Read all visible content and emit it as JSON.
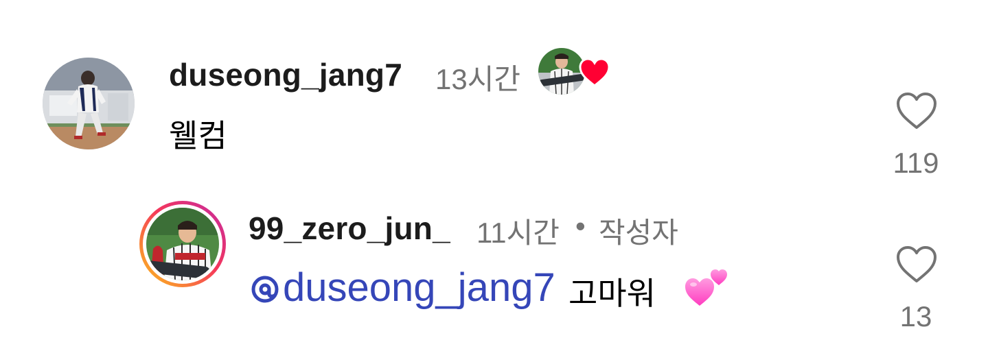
{
  "comment": {
    "username": "duseong_jang7",
    "time": "13시간",
    "text": "웰컴",
    "like_count": "119",
    "icons": {
      "like": "heart-outline-icon",
      "creator_liked": "red-heart-icon"
    }
  },
  "reply": {
    "username": "99_zero_jun_",
    "time": "11시간",
    "separator": "•",
    "author_tag": "작성자",
    "mention": "@duseong_jang7",
    "text": " 고마워",
    "emoji": "💕",
    "like_count": "13",
    "icons": {
      "like": "heart-outline-icon",
      "mention": "threads-at-icon",
      "emoji": "two-hearts-emoji"
    }
  },
  "colors": {
    "username": "#1c1c1c",
    "meta": "#737373",
    "mention": "#3546b8",
    "heart_red": "#ff0033",
    "story_ring": [
      "#fcc419",
      "#f5375b",
      "#c32aa3"
    ]
  }
}
